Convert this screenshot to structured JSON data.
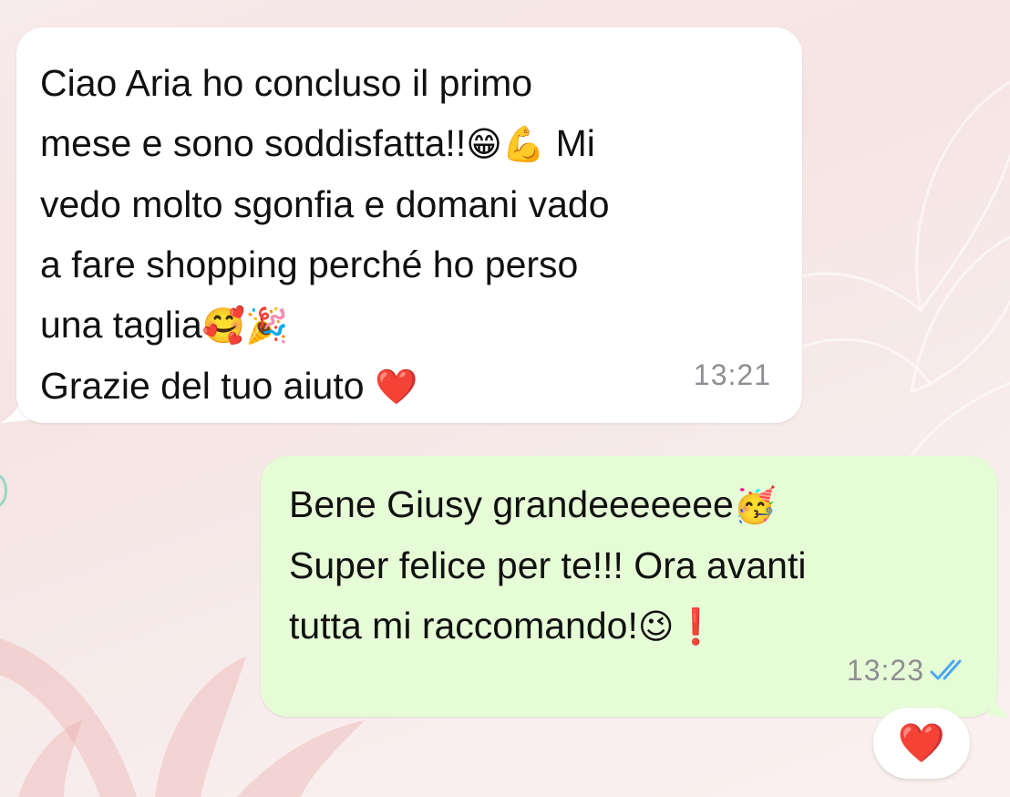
{
  "incoming": {
    "lines": [
      [
        "Ciao Aria ho concluso il primo"
      ],
      [
        "mese e sono soddisfatta!!",
        "😁",
        "💪",
        " Mi"
      ],
      [
        "vedo molto sgonfia e domani vado"
      ],
      [
        "a fare shopping perché ho perso"
      ],
      [
        "una taglia",
        "🥰",
        "🎉"
      ],
      [
        "Grazie del tuo aiuto ",
        "❤️"
      ]
    ],
    "time": "13:21"
  },
  "outgoing": {
    "lines": [
      [
        "Bene Giusy grandeeeeeee",
        "🥳"
      ],
      [
        "Super felice per te!!! Ora avanti"
      ],
      [
        "tutta mi raccomando!",
        "😉",
        " ❗"
      ]
    ],
    "time": "13:23",
    "status_icon": "double-check-read-icon",
    "status_color": "#4aa8f0"
  },
  "reaction": {
    "emoji": "❤️"
  },
  "colors": {
    "incoming_bubble": "#ffffff",
    "outgoing_bubble": "#e6fcd6",
    "timestamp": "#8e8e93",
    "heart": "#e0142b"
  }
}
